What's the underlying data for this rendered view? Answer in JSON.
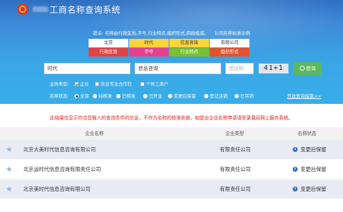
{
  "header": {
    "title": "工商名称查询系统",
    "tip_left": "提示: 名称由行政区划,字号,行业特点,组织形式,四段组成。",
    "tip_right": "公司名称标准示例"
  },
  "segments": [
    {
      "top": "北京",
      "bottom": "行政区划"
    },
    {
      "top": "时代",
      "bottom": "字号"
    },
    {
      "top": "信息咨询",
      "bottom": "行业特点"
    },
    {
      "top": "有限公司",
      "bottom": "组织形式"
    }
  ],
  "search": {
    "tradename_value": "时代",
    "industry_value": "信息咨询",
    "captcha_placeholder": "验证码",
    "captcha_text": "41+1",
    "query_label": "查询"
  },
  "filters": {
    "subject_label": "主体类型:",
    "subject_options": [
      {
        "label": "企业",
        "checked": true
      },
      {
        "label": "农业专业合作社",
        "checked": false
      },
      {
        "label": "个体工商户",
        "checked": false
      }
    ],
    "status_label": "名称状态:",
    "status_options": [
      {
        "label": "全部",
        "checked": true
      },
      {
        "label": "待核准",
        "checked": false
      },
      {
        "label": "已核准",
        "checked": false
      },
      {
        "label": "已开业",
        "checked": false
      },
      {
        "label": "变更后保留",
        "checked": false
      },
      {
        "label": "登记注销",
        "checked": false
      },
      {
        "label": "已吊销",
        "checked": false
      }
    ],
    "guide_link": "开放查询指南>>"
  },
  "notice": "此结果仅显示符合您输入的查询条件的信息，不作为名称的核准依据，如提出企业名称申请请登录我局网上服务系统。",
  "table": {
    "headers": [
      "企业名称",
      "企业类型",
      "名称状态"
    ],
    "rows": [
      {
        "name": "北京大美时代信息咨询有限公司",
        "type": "有限责任公司",
        "status": "变更后保留"
      },
      {
        "name": "北京运时代信息咨询有限责任公司",
        "type": "有限责任公司",
        "status": "变更后保留"
      },
      {
        "name": "北京美时代信息咨询有限公司",
        "type": "有限责任公司",
        "status": "变更后保留"
      }
    ]
  },
  "colors": {
    "header_blue": "#3aa6e6",
    "admin_red": "#e84040",
    "name_pink": "#e93f8a",
    "industry_green": "#7cbf2e",
    "org_orange": "#e6512d",
    "query_green": "#5cb85c",
    "notice_red": "#e02020"
  }
}
